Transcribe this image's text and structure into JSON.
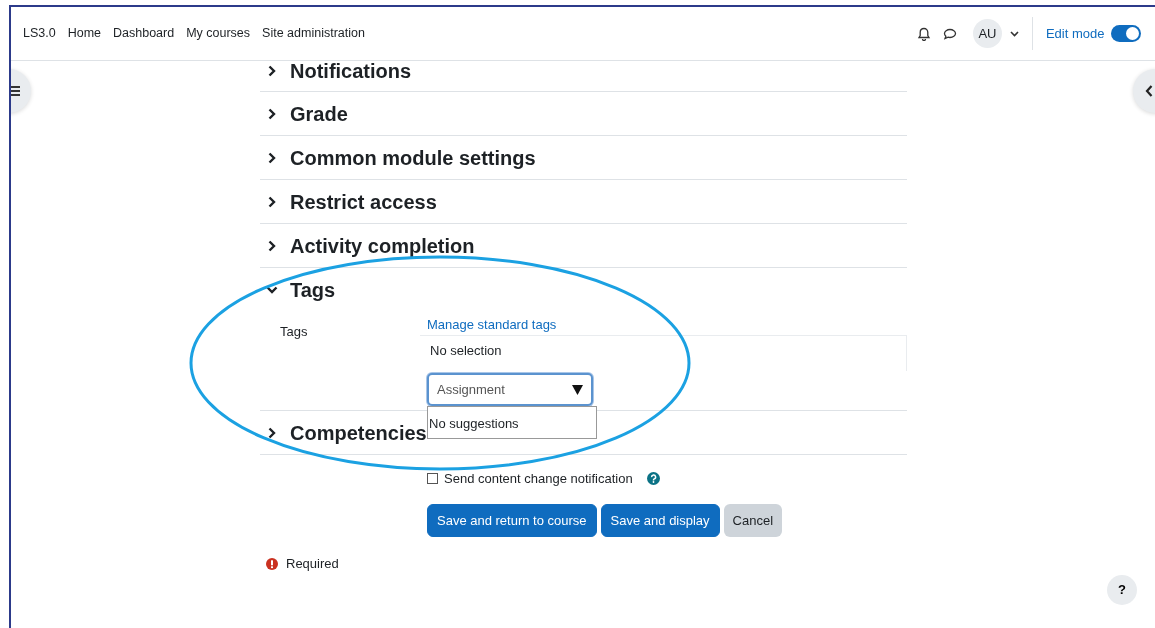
{
  "navbar": {
    "brand": "LS3.0",
    "links": [
      {
        "label": "Home"
      },
      {
        "label": "Dashboard"
      },
      {
        "label": "My courses"
      },
      {
        "label": "Site administration"
      }
    ],
    "avatar": "AU",
    "edit_mode": {
      "label": "Edit mode",
      "on": true
    }
  },
  "sections": [
    {
      "title": "Notifications",
      "expanded": false
    },
    {
      "title": "Grade",
      "expanded": false
    },
    {
      "title": "Common module settings",
      "expanded": false
    },
    {
      "title": "Restrict access",
      "expanded": false
    },
    {
      "title": "Activity completion",
      "expanded": false
    },
    {
      "title": "Tags",
      "expanded": true,
      "content": {
        "label": "Tags",
        "link": "Manage standard tags",
        "selection": "No selection",
        "input": {
          "value": "Assignment"
        },
        "suggestions": "No suggestions"
      }
    },
    {
      "title": "Competencies",
      "expanded": false
    }
  ],
  "notify": {
    "label": "Send content change notification",
    "checked": false
  },
  "buttons": [
    {
      "label": "Save and return to course",
      "kind": "primary"
    },
    {
      "label": "Save and display",
      "kind": "primary"
    },
    {
      "label": "Cancel",
      "kind": "secondary"
    }
  ],
  "required_note": "Required",
  "help_button": "?",
  "annotation": {
    "kind": "ellipse",
    "color": "#1ba1e2"
  }
}
